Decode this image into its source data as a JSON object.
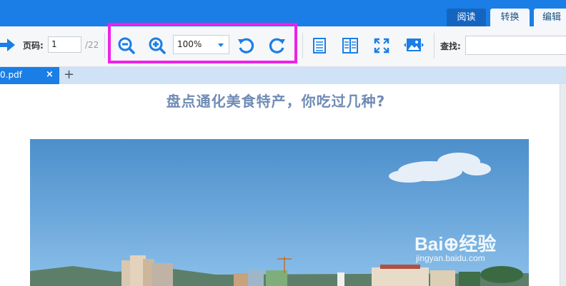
{
  "mode_tabs": [
    {
      "label": "阅读",
      "active": true
    },
    {
      "label": "转换",
      "active": false
    },
    {
      "label": "编辑",
      "active": false
    }
  ],
  "toolbar": {
    "page_label": "页码:",
    "page_value": "1",
    "page_total": "/22",
    "zoom_value": "100%",
    "search_label": "查找:",
    "highlight_color": "#ee22e8"
  },
  "file_tab": {
    "name": "0.pdf",
    "close_glyph": "×",
    "add_glyph": "+"
  },
  "document": {
    "title": "盘点通化美食特产，你吃过几种?"
  },
  "watermark": {
    "brand": "Bai⊕经验",
    "url": "jingyan.baidu.com"
  },
  "colors": {
    "accent": "#1a7ee6",
    "title": "#6f8bb5"
  }
}
